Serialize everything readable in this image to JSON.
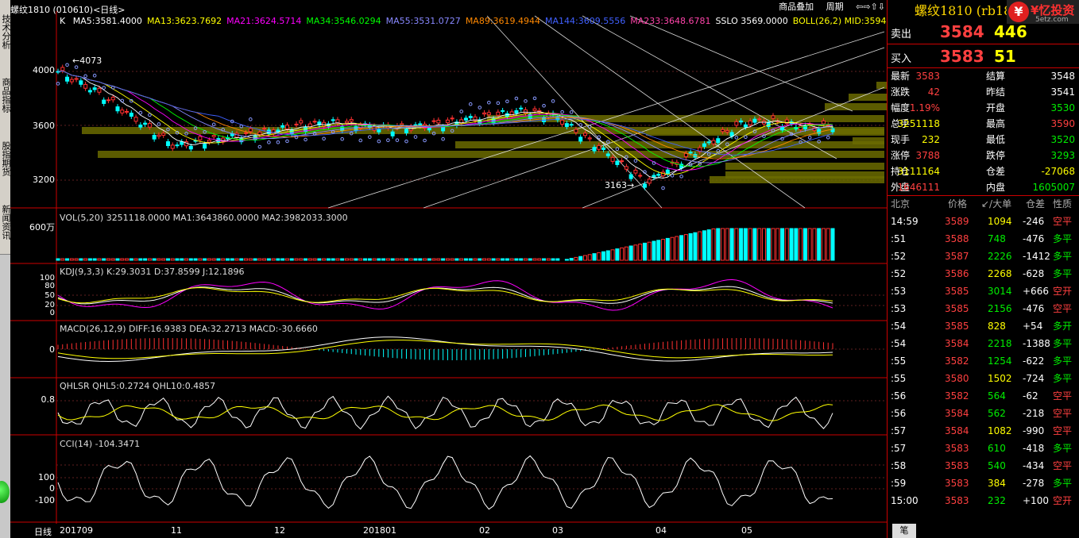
{
  "left_tabs": [
    "技术分析",
    "商品指标",
    "股指期货",
    "新闻资讯"
  ],
  "period_label": "日线",
  "main": {
    "title": "螺纹1810 (010610)<日线>",
    "k": "K",
    "ma": [
      {
        "label": "MA5:3581.4000",
        "color": "#ffffff"
      },
      {
        "label": "MA13:3623.7692",
        "color": "#ffff00"
      },
      {
        "label": "MA21:3624.5714",
        "color": "#ff00ff"
      },
      {
        "label": "MA34:3546.0294",
        "color": "#00ff00"
      },
      {
        "label": "MA55:3531.0727",
        "color": "#8888ff"
      },
      {
        "label": "MA89:3619.4944",
        "color": "#ff8800"
      },
      {
        "label": "MA144:3609.5556",
        "color": "#4060ff"
      },
      {
        "label": "MA233:3648.6781",
        "color": "#ff44aa"
      },
      {
        "label": "SSLO 3569.0000",
        "color": "#ffffff"
      },
      {
        "label": "BOLL(26,2) MID:3594",
        "color": "#ffff00"
      }
    ],
    "y_labels": [
      "4000",
      "3600",
      "3200"
    ],
    "high_label": "4073",
    "low_label": "3163"
  },
  "toolbar": {
    "a": "商品叠加",
    "b": "周期",
    "c": "⇦⇨⇧⇩"
  },
  "vol": {
    "label": "VOL(5,20) 3251118.0000 MA1:3643860.0000 MA2:3982033.3000",
    "y": "600万"
  },
  "kdj": {
    "label": "KDJ(9,3,3) K:29.3031 D:37.8599 J:12.1896",
    "y": [
      "100",
      "80",
      "50",
      "20",
      "0"
    ]
  },
  "macd": {
    "label": "MACD(26,12,9) DIFF:16.9383 DEA:32.2713 MACD:-30.6660",
    "y": "0"
  },
  "qhlsr": {
    "label": "QHLSR QHL5:0.2724 QHL10:0.4857",
    "y": "0.8"
  },
  "cci": {
    "label": "CCI(14) -104.3471",
    "y": [
      "100",
      "0",
      "-100"
    ]
  },
  "x_labels": [
    "201709",
    "11",
    "12",
    "201801",
    "02",
    "03",
    "04",
    "05"
  ],
  "right": {
    "title": "螺纹1810 (rb1810)",
    "logo": "¥忆投资",
    "logo_icon": "¥",
    "logo_url": "5etz.com",
    "sell": {
      "label": "卖出",
      "price": "3584",
      "vol": "446"
    },
    "buy": {
      "label": "买入",
      "price": "3583",
      "vol": "51"
    },
    "stats": [
      [
        "最新",
        "3583",
        "red",
        "结算",
        "3548",
        "wht"
      ],
      [
        "涨跌",
        "42",
        "red",
        "昨结",
        "3541",
        "wht"
      ],
      [
        "幅度",
        "1.19%",
        "red",
        "开盘",
        "3530",
        "grn"
      ],
      [
        "总手",
        "3251118",
        "yel",
        "最高",
        "3590",
        "red"
      ],
      [
        "现手",
        "232",
        "yel",
        "最低",
        "3520",
        "grn"
      ],
      [
        "涨停",
        "3788",
        "red",
        "跌停",
        "3293",
        "grn"
      ],
      [
        "持仓",
        "3111164",
        "yel",
        "仓差",
        "-27068",
        "yel"
      ],
      [
        "外盘",
        "1646111",
        "red",
        "内盘",
        "1605007",
        "grn"
      ]
    ],
    "tick_head": [
      "北京",
      "价格",
      "↙/大单",
      "仓差",
      "性质"
    ],
    "ticks": [
      [
        "14:59",
        "3589",
        "1094",
        "-246",
        "空平"
      ],
      [
        ":51",
        "3588",
        "748",
        "-476",
        "多平"
      ],
      [
        ":52",
        "3587",
        "2226",
        "-1412",
        "多平"
      ],
      [
        ":52",
        "3586",
        "2268",
        "-628",
        "多平"
      ],
      [
        ":53",
        "3585",
        "3014",
        "+666",
        "空开"
      ],
      [
        ":53",
        "3585",
        "2156",
        "-476",
        "空平"
      ],
      [
        ":54",
        "3585",
        "828",
        "+54",
        "多开"
      ],
      [
        ":54",
        "3584",
        "2218",
        "-1388",
        "多平"
      ],
      [
        ":55",
        "3582",
        "1254",
        "-622",
        "多平"
      ],
      [
        ":55",
        "3580",
        "1502",
        "-724",
        "多平"
      ],
      [
        ":56",
        "3582",
        "564",
        "-62",
        "空平"
      ],
      [
        ":56",
        "3584",
        "562",
        "-218",
        "空平"
      ],
      [
        ":57",
        "3584",
        "1082",
        "-990",
        "空平"
      ],
      [
        ":57",
        "3583",
        "610",
        "-418",
        "多平"
      ],
      [
        ":58",
        "3583",
        "540",
        "-434",
        "空平"
      ],
      [
        ":59",
        "3583",
        "384",
        "-278",
        "多平"
      ],
      [
        "15:00",
        "3583",
        "232",
        "+100",
        "空开"
      ]
    ],
    "bottom_tab": "笔"
  }
}
